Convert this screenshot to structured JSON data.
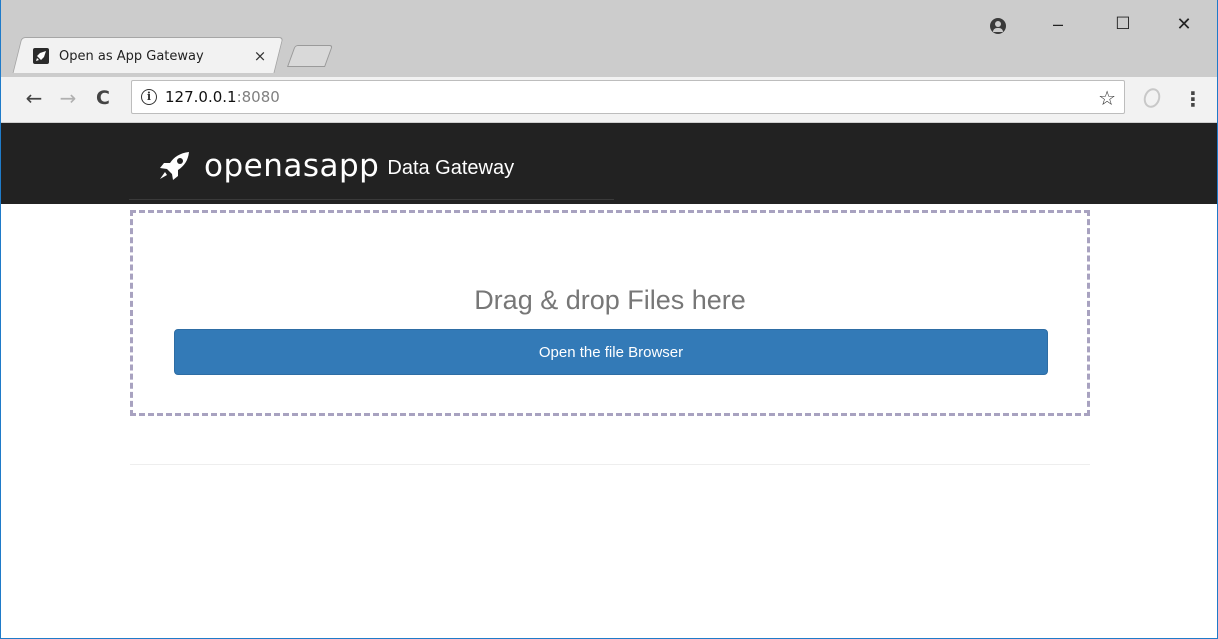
{
  "browser": {
    "tab": {
      "title": "Open as App Gateway",
      "close_glyph": "×",
      "favicon": "rocket-icon"
    },
    "window_controls": {
      "minimize": "–",
      "maximize": "☐",
      "close": "✕"
    },
    "nav": {
      "back": "←",
      "forward": "→",
      "reload": "C"
    },
    "address": {
      "host": "127.0.0.1",
      "port": ":8080",
      "info_glyph": "i"
    },
    "star_glyph": "☆",
    "menu_glyph": "⋮"
  },
  "header": {
    "brand_word": "openasapp",
    "brand_subtitle": "Data Gateway",
    "background": "#222222"
  },
  "dropzone": {
    "prompt": "Drag & drop Files here",
    "button_label": "Open the file Browser",
    "border_color": "#a8a2c0",
    "button_color": "#337ab7"
  }
}
